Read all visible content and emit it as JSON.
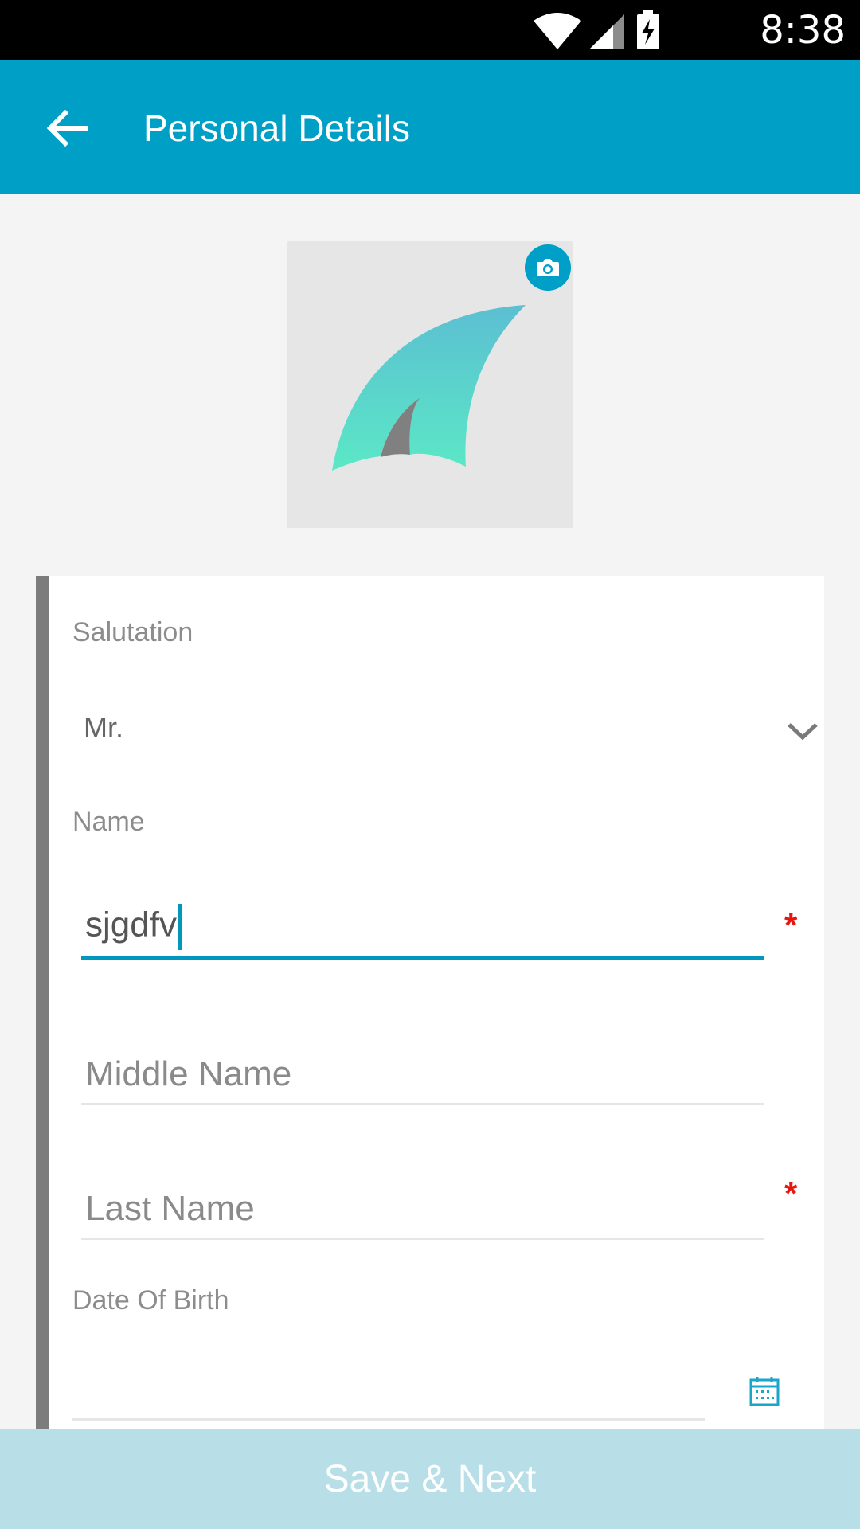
{
  "status_bar": {
    "time": "8:38",
    "icons": [
      "wifi-icon",
      "signal-icon",
      "battery-charging-icon"
    ]
  },
  "app_bar": {
    "title": "Personal Details",
    "back_icon": "arrow-back-icon",
    "background": "#00a0c6"
  },
  "profile": {
    "camera_icon": "camera-icon"
  },
  "form": {
    "salutation": {
      "label": "Salutation",
      "value": "Mr."
    },
    "name_section_label": "Name",
    "first_name": {
      "value": "sjgdfv",
      "required_mark": "*"
    },
    "middle_name": {
      "placeholder": "Middle Name"
    },
    "last_name": {
      "placeholder": "Last Name",
      "required_mark": "*"
    },
    "dob": {
      "label": "Date Of Birth",
      "icon": "calendar-icon"
    }
  },
  "footer": {
    "save_label": "Save & Next"
  },
  "colors": {
    "accent": "#00a0c6",
    "required": "#e8150f",
    "save_bar": "#b8dfe8"
  }
}
